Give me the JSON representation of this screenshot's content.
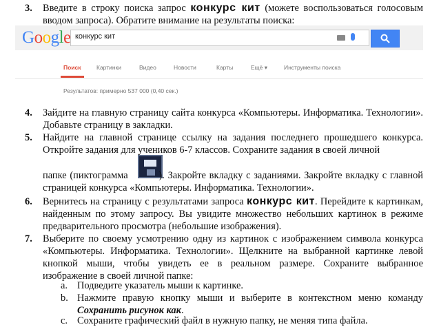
{
  "items": {
    "i3": {
      "num": "3.",
      "pre": "Введите в строку поиска запрос ",
      "query": "конкурс кит",
      "post": " (можете воспользоваться голосовым вводом запроса). Обратите внимание на результаты поиска:"
    },
    "i4": {
      "num": "4.",
      "text": "Зайдите на главную страницу сайта конкурса «Компьютеры. Информатика. Технологии». Добавьте страницу в закладки."
    },
    "i5": {
      "num": "5.",
      "line1": "Найдите на главной странице ссылку на задания последнего прошедшего конкурса. Откройте задания для учеников 6-7 классов. Сохраните задания в своей личной",
      "line2_pre": "папке (пиктограмма ",
      "line2_post": "). Закройте вкладку с заданиями. Закройте вкладку с главной страницей конкурса «Компьютеры. Информатика. Технологии»."
    },
    "i6": {
      "num": "6.",
      "pre": "Вернитесь на страницу с результатами запроса ",
      "query": "конкурс кит",
      "post": ". Перейдите к картинкам, найденным по этому запросу. Вы увидите множество небольших картинок в режиме предварительного просмотра (небольшие изображения)."
    },
    "i7": {
      "num": "7.",
      "text": "Выберите по своему усмотрению одну из картинок с изображением символа конкурса «Компьютеры. Информатика. Технологии».  Щелкните на выбранной картинке левой кнопкой мыши, чтобы увидеть ее в реальном размере. Сохраните выбранное изображение в своей личной папке:"
    },
    "sub_a": {
      "letter": "a.",
      "text": "Подведите указатель мыши к картинке."
    },
    "sub_b": {
      "letter": "b.",
      "pre": "Нажмите правую кнопку мыши и выберите в контекстном меню команду ",
      "cmd": "Сохранить рисунок как",
      "post": "."
    },
    "sub_c": {
      "letter": "c.",
      "text": "Сохраните графический файл в нужную папку, не меняя типа файла."
    }
  },
  "google": {
    "logo": "Google",
    "query": "конкурс кит",
    "tabs": [
      "Поиск",
      "Картинки",
      "Видео",
      "Новости",
      "Карты",
      "Ещё ▾",
      "Инструменты поиска"
    ],
    "results": "Результатов: примерно 537 000 (0,40 сек.)",
    "colors": {
      "blue": "#4285f4",
      "red": "#dd4b39",
      "header": "#f1f1f1"
    }
  }
}
